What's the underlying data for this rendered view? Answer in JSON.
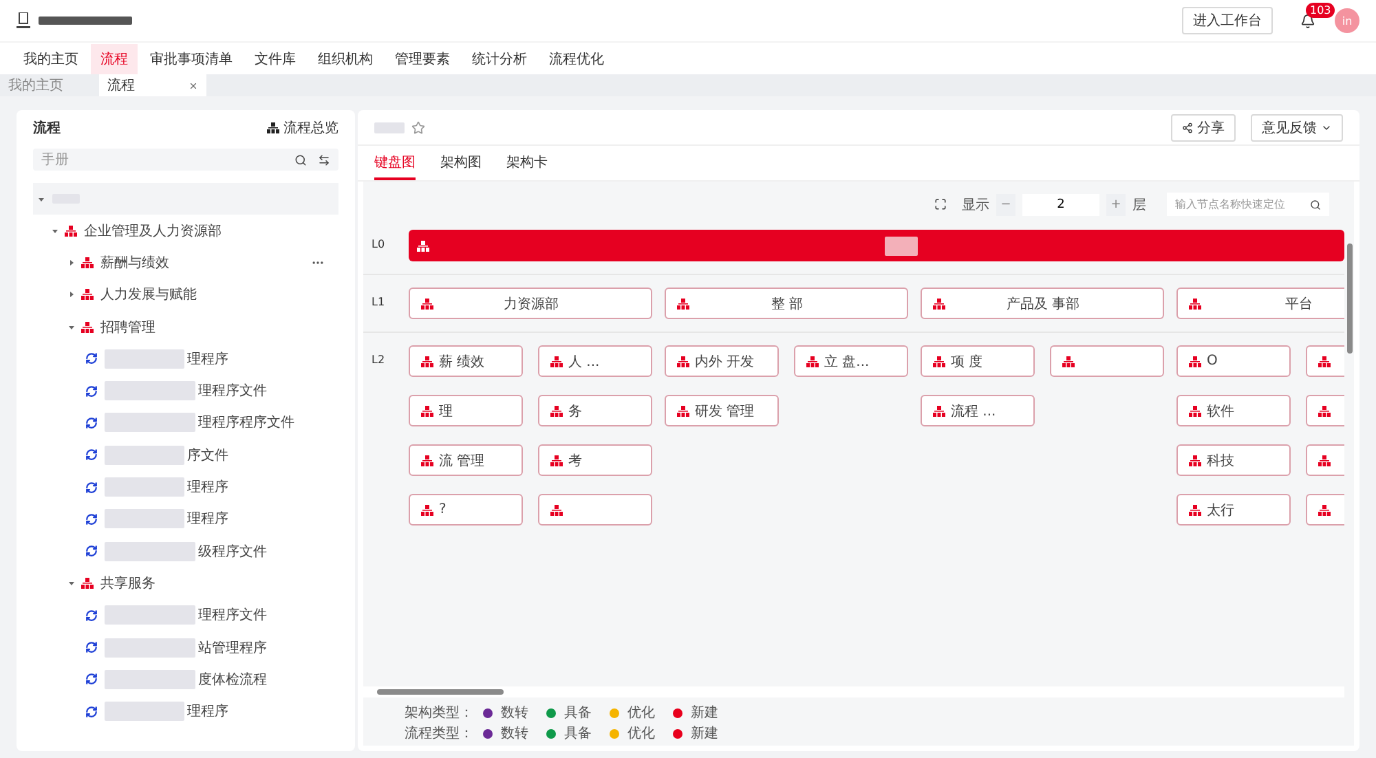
{
  "header": {
    "workspace_button": "进入工作台",
    "notification_count": "103",
    "avatar": "in"
  },
  "nav": [
    {
      "label": "我的主页",
      "selected": false
    },
    {
      "label": "流程",
      "selected": true
    },
    {
      "label": "审批事项清单",
      "selected": false
    },
    {
      "label": "文件库",
      "selected": false
    },
    {
      "label": "组织机构",
      "selected": false
    },
    {
      "label": "管理要素",
      "selected": false
    },
    {
      "label": "统计分析",
      "selected": false
    },
    {
      "label": "流程优化",
      "selected": false
    }
  ],
  "page_tabs": [
    {
      "label": "我的主页",
      "selected": false,
      "closable": false
    },
    {
      "label": "流程",
      "selected": true,
      "closable": true
    }
  ],
  "sidebar": {
    "title": "流程",
    "overview_link": "流程总览",
    "search": {
      "placeholder": "手册"
    },
    "tree": [
      {
        "kind": "root",
        "expanded": true,
        "children": [
          {
            "kind": "org",
            "label": "企业管理及人力资源部",
            "expanded": true,
            "children": [
              {
                "kind": "org",
                "label": "薪酬与绩效",
                "expanded": false,
                "more": true
              },
              {
                "kind": "org",
                "label": "人力发展与赋能",
                "expanded": false
              },
              {
                "kind": "org",
                "label": "招聘管理",
                "expanded": true,
                "children": [
                  {
                    "kind": "process",
                    "label": "理程序"
                  },
                  {
                    "kind": "process",
                    "label": "理程序文件"
                  },
                  {
                    "kind": "process",
                    "label": "理程序程序文件"
                  },
                  {
                    "kind": "process",
                    "label": "序文件"
                  },
                  {
                    "kind": "process",
                    "label": "理程序"
                  },
                  {
                    "kind": "process",
                    "label": "理程序"
                  },
                  {
                    "kind": "process",
                    "label": "级程序文件"
                  }
                ]
              },
              {
                "kind": "org",
                "label": "共享服务",
                "expanded": true,
                "children": [
                  {
                    "kind": "process",
                    "label": "理程序文件"
                  },
                  {
                    "kind": "process",
                    "label": "站管理程序"
                  },
                  {
                    "kind": "process",
                    "label": "度体检流程"
                  },
                  {
                    "kind": "process",
                    "label": "理程序"
                  }
                ]
              }
            ]
          }
        ]
      }
    ]
  },
  "content": {
    "share_button": "分享",
    "feedback_button": "意见反馈",
    "tabs": [
      {
        "label": "键盘图",
        "selected": true
      },
      {
        "label": "架构图",
        "selected": false
      },
      {
        "label": "架构卡",
        "selected": false
      }
    ],
    "toolbar": {
      "show_label": "显示",
      "minus": "−",
      "depth": "2",
      "plus": "+",
      "unit": "层",
      "search": {
        "placeholder": "输入节点名称快速定位"
      }
    },
    "levels": [
      "L0",
      "L1",
      "L2"
    ],
    "columns": [
      {
        "label": "力资源部",
        "groups": [
          [
            {
              "kind": "labeled",
              "label": "薪 绩效"
            },
            {
              "kind": "labeled",
              "label": "理"
            },
            {
              "kind": "labeled",
              "label": "流 管理"
            },
            {
              "kind": "labeled",
              "label": "?"
            }
          ],
          [
            {
              "kind": "labeled",
              "label": "人 ..."
            },
            {
              "kind": "labeled",
              "label": "务"
            },
            {
              "kind": "labeled",
              "label": "考"
            },
            {
              "kind": "blank"
            }
          ]
        ]
      },
      {
        "label": "整 部",
        "groups": [
          [
            {
              "kind": "labeled",
              "label": "内外 开发"
            },
            {
              "kind": "labeled",
              "label": "研发 管理"
            }
          ],
          [
            {
              "kind": "labeled",
              "label": "立 盘..."
            }
          ]
        ]
      },
      {
        "label": "产品及 事部",
        "groups": [
          [
            {
              "kind": "labeled",
              "label": "项 度"
            },
            {
              "kind": "labeled",
              "label": "流程 ..."
            }
          ],
          [
            {
              "kind": "blank"
            }
          ]
        ]
      },
      {
        "label": "平台",
        "groups": [
          [
            {
              "kind": "labeled",
              "label": "O"
            },
            {
              "kind": "labeled",
              "label": "软件"
            },
            {
              "kind": "labeled",
              "label": "科技"
            },
            {
              "kind": "labeled",
              "label": "太行"
            }
          ],
          [
            {
              "kind": "blank"
            },
            {
              "kind": "blank"
            },
            {
              "kind": "blank"
            },
            {
              "kind": "blank"
            }
          ]
        ]
      }
    ],
    "legend": [
      {
        "label": "架构类型：",
        "items": [
          {
            "label": "数转",
            "color": "#6b2a96"
          },
          {
            "label": "具备",
            "color": "#0f9a4a"
          },
          {
            "label": "优化",
            "color": "#f5b400"
          },
          {
            "label": "新建",
            "color": "#e8001c"
          }
        ]
      },
      {
        "label": "流程类型：",
        "items": [
          {
            "label": "数转",
            "color": "#6b2a96"
          },
          {
            "label": "具备",
            "color": "#0f9a4a"
          },
          {
            "label": "优化",
            "color": "#f5b400"
          },
          {
            "label": "新建",
            "color": "#e8001c"
          }
        ]
      }
    ]
  }
}
